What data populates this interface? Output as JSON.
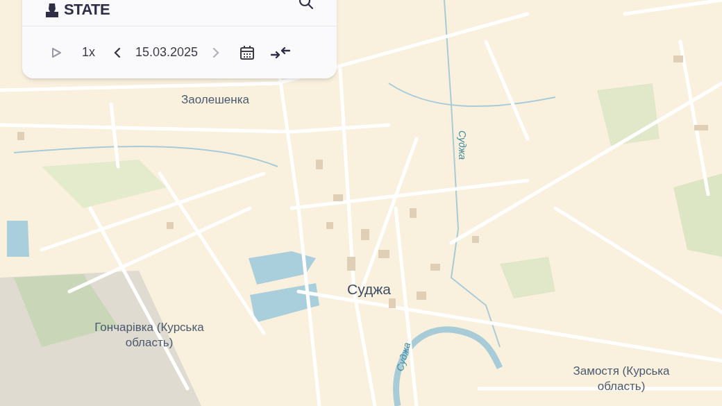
{
  "panel": {
    "brand": "STATE",
    "player": {
      "playing": false,
      "speed": "1x",
      "date": "15.03.2025",
      "next_disabled": true
    }
  },
  "map": {
    "labels": [
      {
        "kind": "place",
        "text": "Заолешенка"
      },
      {
        "kind": "river",
        "text": "Суджа"
      },
      {
        "kind": "town",
        "text": "Суджа"
      },
      {
        "kind": "place",
        "text": "Гончарівка (Курська область)"
      },
      {
        "kind": "river",
        "text": "Суджа"
      },
      {
        "kind": "place",
        "text": "Замостя (Курська область)"
      }
    ]
  }
}
